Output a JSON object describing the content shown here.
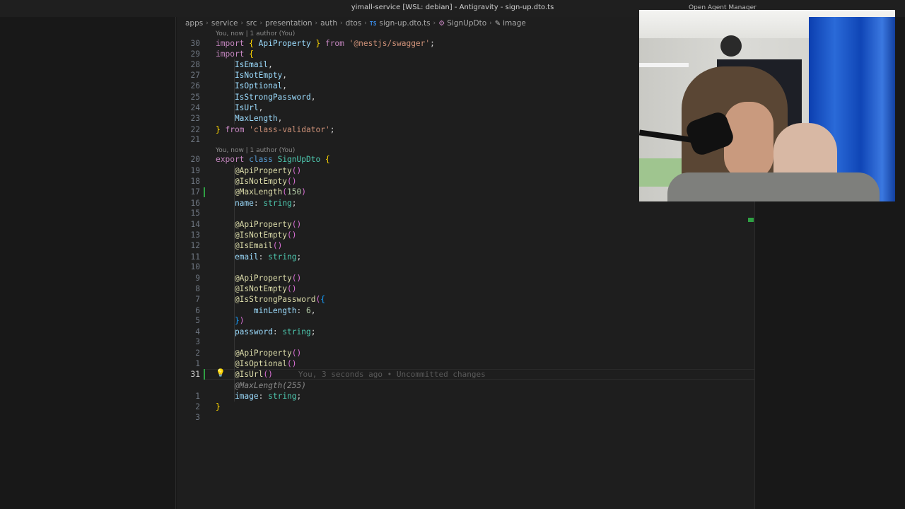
{
  "window": {
    "title": "yimall-service [WSL: debian] - Antigravity - sign-up.dto.ts",
    "agent_manager_label": "Open Agent Manager"
  },
  "breadcrumb": {
    "segments": [
      "apps",
      "service",
      "src",
      "presentation",
      "auth",
      "dtos"
    ],
    "file_badge": "TS",
    "file": "sign-up.dto.ts",
    "class_symbol": "SignUpDto",
    "property_symbol": "image"
  },
  "codelens": {
    "import_block": "You, now | 1 author (You)",
    "class_block": "You, now | 1 author (You)"
  },
  "inline_blame": "You, 3 seconds ago • Uncommitted changes",
  "code": {
    "lines": [
      {
        "n": "30",
        "tokens": [
          [
            "imp",
            "import "
          ],
          [
            "br1",
            "{ "
          ],
          [
            "id",
            "ApiProperty"
          ],
          [
            "br1",
            " }"
          ],
          [
            "imp",
            " from "
          ],
          [
            "str",
            "'@nestjs/swagger'"
          ],
          [
            "pun",
            ";"
          ]
        ]
      },
      {
        "n": "29",
        "tokens": [
          [
            "imp",
            "import "
          ],
          [
            "br1",
            "{"
          ]
        ]
      },
      {
        "n": "28",
        "tokens": [
          [
            "id",
            "    IsEmail"
          ],
          [
            "pun",
            ","
          ]
        ]
      },
      {
        "n": "27",
        "tokens": [
          [
            "id",
            "    IsNotEmpty"
          ],
          [
            "pun",
            ","
          ]
        ]
      },
      {
        "n": "26",
        "tokens": [
          [
            "id",
            "    IsOptional"
          ],
          [
            "pun",
            ","
          ]
        ]
      },
      {
        "n": "25",
        "tokens": [
          [
            "id",
            "    IsStrongPassword"
          ],
          [
            "pun",
            ","
          ]
        ]
      },
      {
        "n": "24",
        "tokens": [
          [
            "id",
            "    IsUrl"
          ],
          [
            "pun",
            ","
          ]
        ]
      },
      {
        "n": "23",
        "tokens": [
          [
            "id",
            "    MaxLength"
          ],
          [
            "pun",
            ","
          ]
        ]
      },
      {
        "n": "22",
        "tokens": [
          [
            "br1",
            "} "
          ],
          [
            "imp",
            "from "
          ],
          [
            "str",
            "'class-validator'"
          ],
          [
            "pun",
            ";"
          ]
        ]
      },
      {
        "n": "21",
        "tokens": []
      },
      {
        "n": "20",
        "tokens": [
          [
            "imp",
            "export "
          ],
          [
            "kw",
            "class "
          ],
          [
            "cls",
            "SignUpDto"
          ],
          [
            "br1",
            " {"
          ]
        ]
      },
      {
        "n": "19",
        "tokens": [
          [
            "fn",
            "    @ApiProperty"
          ],
          [
            "br2",
            "()"
          ]
        ]
      },
      {
        "n": "18",
        "tokens": [
          [
            "fn",
            "    @IsNotEmpty"
          ],
          [
            "br2",
            "()"
          ]
        ]
      },
      {
        "n": "17",
        "tokens": [
          [
            "fn",
            "    @MaxLength"
          ],
          [
            "br2",
            "("
          ],
          [
            "num",
            "150"
          ],
          [
            "br2",
            ")"
          ]
        ]
      },
      {
        "n": "16",
        "tokens": [
          [
            "id",
            "    name"
          ],
          [
            "pun",
            ": "
          ],
          [
            "cls",
            "string"
          ],
          [
            "pun",
            ";"
          ]
        ]
      },
      {
        "n": "15",
        "tokens": []
      },
      {
        "n": "14",
        "tokens": [
          [
            "fn",
            "    @ApiProperty"
          ],
          [
            "br2",
            "()"
          ]
        ]
      },
      {
        "n": "13",
        "tokens": [
          [
            "fn",
            "    @IsNotEmpty"
          ],
          [
            "br2",
            "()"
          ]
        ]
      },
      {
        "n": "12",
        "tokens": [
          [
            "fn",
            "    @IsEmail"
          ],
          [
            "br2",
            "()"
          ]
        ]
      },
      {
        "n": "11",
        "tokens": [
          [
            "id",
            "    email"
          ],
          [
            "pun",
            ": "
          ],
          [
            "cls",
            "string"
          ],
          [
            "pun",
            ";"
          ]
        ]
      },
      {
        "n": "10",
        "tokens": []
      },
      {
        "n": "9",
        "tokens": [
          [
            "fn",
            "    @ApiProperty"
          ],
          [
            "br2",
            "()"
          ]
        ]
      },
      {
        "n": "8",
        "tokens": [
          [
            "fn",
            "    @IsNotEmpty"
          ],
          [
            "br2",
            "()"
          ]
        ]
      },
      {
        "n": "7",
        "tokens": [
          [
            "fn",
            "    @IsStrongPassword"
          ],
          [
            "br2",
            "("
          ],
          [
            "br3",
            "{"
          ]
        ]
      },
      {
        "n": "6",
        "tokens": [
          [
            "id",
            "        minLength"
          ],
          [
            "pun",
            ": "
          ],
          [
            "num",
            "6"
          ],
          [
            "pun",
            ","
          ]
        ]
      },
      {
        "n": "5",
        "tokens": [
          [
            "br3",
            "    }"
          ],
          [
            "br2",
            ")"
          ]
        ]
      },
      {
        "n": "4",
        "tokens": [
          [
            "id",
            "    password"
          ],
          [
            "pun",
            ": "
          ],
          [
            "cls",
            "string"
          ],
          [
            "pun",
            ";"
          ]
        ]
      },
      {
        "n": "3",
        "tokens": []
      },
      {
        "n": "2",
        "tokens": [
          [
            "fn",
            "    @ApiProperty"
          ],
          [
            "br2",
            "()"
          ]
        ]
      },
      {
        "n": "1",
        "tokens": [
          [
            "fn",
            "    @IsOptional"
          ],
          [
            "br2",
            "()"
          ]
        ]
      },
      {
        "n": "31",
        "current": true,
        "tokens": [
          [
            "fn",
            "    @IsUrl"
          ],
          [
            "br2",
            "()"
          ]
        ]
      },
      {
        "n": "",
        "tokens": [
          [
            "ghost",
            "    @MaxLength(255)"
          ]
        ]
      },
      {
        "n": "1",
        "tokens": [
          [
            "id",
            "    image"
          ],
          [
            "pun",
            ": "
          ],
          [
            "cls",
            "string"
          ],
          [
            "pun",
            ";"
          ]
        ]
      },
      {
        "n": "2",
        "tokens": [
          [
            "br1",
            "}"
          ]
        ]
      },
      {
        "n": "3",
        "tokens": []
      }
    ]
  },
  "colors": {
    "git_added": "#2ea043",
    "git_modified": "#2f7bbf",
    "background": "#1e1e1e"
  }
}
